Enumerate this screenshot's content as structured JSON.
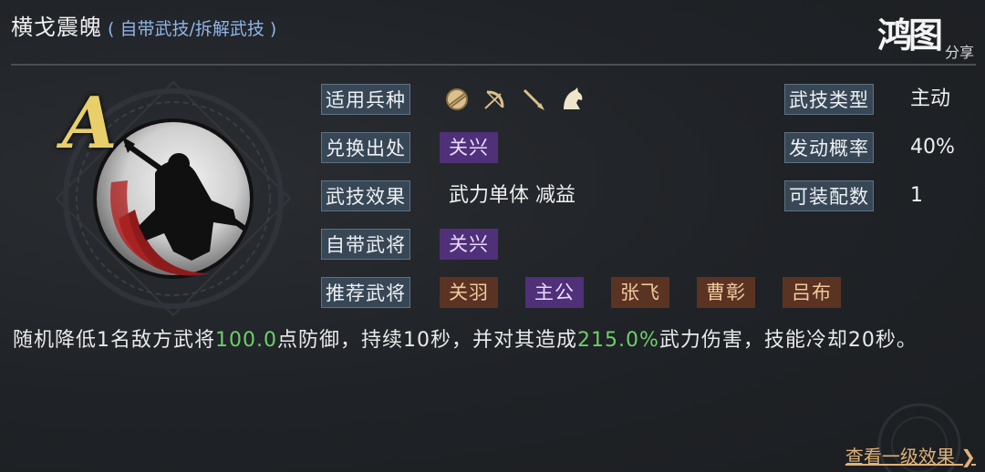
{
  "header": {
    "title": "横戈震魄",
    "subtitle": "( 自带武技/拆解武技 )"
  },
  "logo": {
    "main": "鸿图",
    "sub": "分享"
  },
  "grade": "A",
  "left_rows": [
    {
      "label": "适用兵种"
    },
    {
      "label": "兑换出处",
      "tags": [
        {
          "text": "关兴",
          "style": "purple"
        }
      ]
    },
    {
      "label": "武技效果",
      "value": "武力单体 减益"
    },
    {
      "label": "自带武将",
      "tags": [
        {
          "text": "关兴",
          "style": "purple"
        }
      ]
    },
    {
      "label": "推荐武将",
      "tags": [
        {
          "text": "关羽",
          "style": "brown"
        },
        {
          "text": "主公",
          "style": "purple"
        },
        {
          "text": "张飞",
          "style": "brown"
        },
        {
          "text": "曹彰",
          "style": "brown"
        },
        {
          "text": "吕布",
          "style": "brown"
        }
      ]
    }
  ],
  "troop_icons": [
    "shield-icon",
    "bow-icon",
    "spear-icon",
    "horse-icon"
  ],
  "right_rows": [
    {
      "label": "武技类型",
      "value": "主动"
    },
    {
      "label": "发动概率",
      "value": "40%"
    },
    {
      "label": "可装配数",
      "value": "1"
    }
  ],
  "description": {
    "p1": "随机降低1名敌方武将",
    "h1": "100.0",
    "p2": "点防御，持续10秒，并对其造成",
    "h2": "215.0%",
    "p3": "武力伤害，技能冷却20秒。"
  },
  "footer": {
    "link": "查看一级效果 ❯"
  },
  "colors": {
    "highlight": "#6dcf6a",
    "link": "#e1b177",
    "purple_tag": "#4f3079",
    "brown_tag": "#5a3323",
    "label_bg": "#374756"
  }
}
